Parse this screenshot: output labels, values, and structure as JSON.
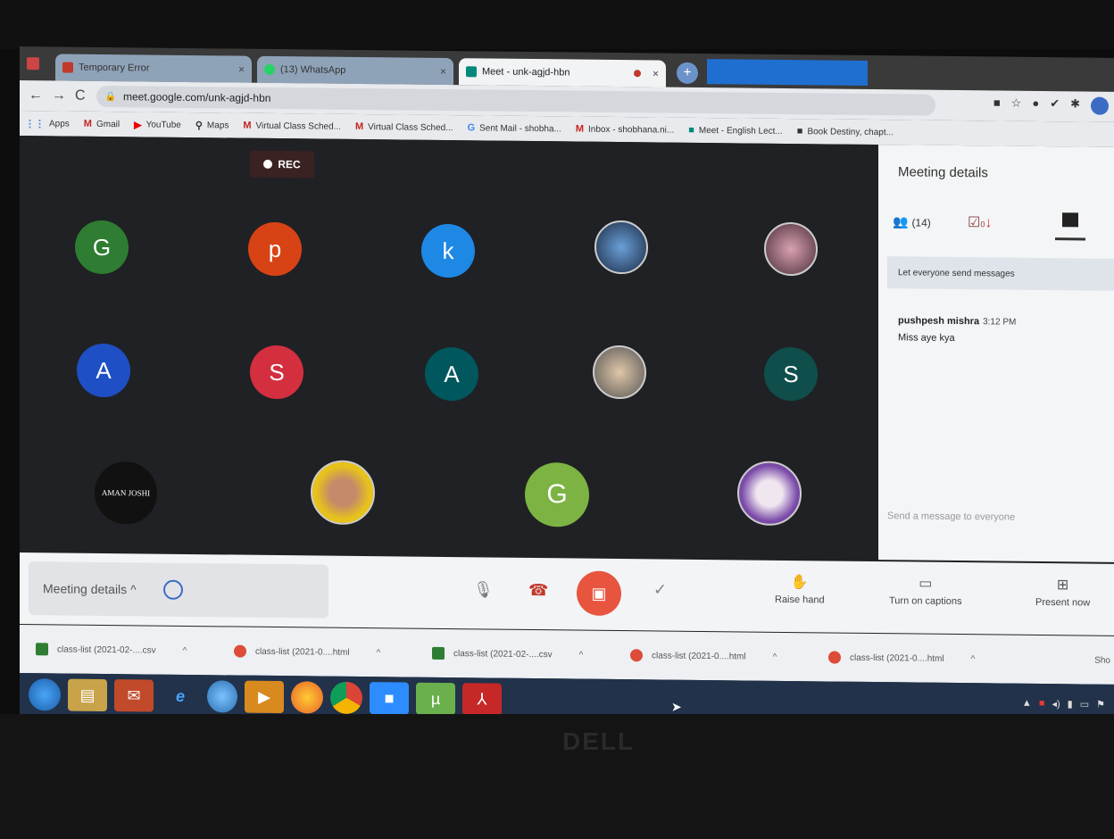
{
  "tabs": [
    {
      "label": "Temporary Error",
      "icon_color": "#c0392b"
    },
    {
      "label": "(13) WhatsApp",
      "icon_color": "#25d366"
    },
    {
      "label": "Meet - unk-agjd-hbn",
      "icon_color": "#00897b"
    }
  ],
  "address": {
    "url": "meet.google.com/unk-agjd-hbn"
  },
  "bookmarks": [
    {
      "label": "Apps",
      "icon": "apps-grid-icon"
    },
    {
      "label": "Gmail",
      "icon": "gmail-icon"
    },
    {
      "label": "YouTube",
      "icon": "youtube-icon"
    },
    {
      "label": "Maps",
      "icon": "maps-icon"
    },
    {
      "label": "Virtual Class Sched...",
      "icon": "gmail-icon"
    },
    {
      "label": "Virtual Class Sched...",
      "icon": "gmail-icon"
    },
    {
      "label": "Sent Mail - shobha...",
      "icon": "google-icon"
    },
    {
      "label": "Inbox - shobhana.ni...",
      "icon": "gmail-icon"
    },
    {
      "label": "Meet - English Lect...",
      "icon": "meet-icon"
    },
    {
      "label": "Book Destiny, chapt...",
      "icon": "book-icon"
    }
  ],
  "meeting": {
    "rec_label": "REC",
    "participants": [
      {
        "letter": "G",
        "color": "#2e7d32"
      },
      {
        "letter": "p",
        "color": "#d84315"
      },
      {
        "letter": "k",
        "color": "#1e88e5"
      },
      {
        "letter": "",
        "color": "#3a5a8a",
        "photo": true
      },
      {
        "letter": "",
        "color": "#6a4c63",
        "photo": true
      },
      {
        "letter": "A",
        "color": "#1e4fc4"
      },
      {
        "letter": "S",
        "color": "#d32f3f"
      },
      {
        "letter": "A",
        "color": "#00575e"
      },
      {
        "letter": "",
        "color": "#aaaaaa",
        "photo": true
      },
      {
        "letter": "S",
        "color": "#0f4e4a"
      },
      {
        "letter": "AMAN JOSHI",
        "color": "#111111"
      },
      {
        "letter": "",
        "color": "#e7c21b",
        "photo": true
      },
      {
        "letter": "G",
        "color": "#7cb342"
      },
      {
        "letter": "",
        "color": "#7a4aa8",
        "photo": true
      }
    ]
  },
  "panel": {
    "title": "Meeting details",
    "people_count": "(14)",
    "attendance_count": "0",
    "let_everyone": "Let everyone send messages",
    "message": {
      "sender": "pushpesh mishra",
      "time": "3:12 PM",
      "text": "Miss aye kya"
    },
    "send_placeholder": "Send a message to everyone"
  },
  "controls": {
    "meeting_details": "Meeting details",
    "raise_hand": "Raise hand",
    "captions": "Turn on captions",
    "present": "Present now"
  },
  "downloads": [
    {
      "label": "class-list (2021-02-....csv",
      "icon_color": "#2e7d32"
    },
    {
      "label": "class-list (2021-0....html",
      "icon_color": "#dd4b39"
    },
    {
      "label": "class-list (2021-02-....csv",
      "icon_color": "#2e7d32"
    },
    {
      "label": "class-list (2021-0....html",
      "icon_color": "#dd4b39"
    },
    {
      "label": "class-list (2021-0....html",
      "icon_color": "#dd4b39"
    }
  ],
  "downloads_show_all": "Sho",
  "taskbar": [
    {
      "name": "explorer",
      "color": "#c9a34a"
    },
    {
      "name": "outlook",
      "color": "#c14a2a"
    },
    {
      "name": "ie",
      "color": "#2d6fc4"
    },
    {
      "name": "circle-app",
      "color": "#3c8fd8"
    },
    {
      "name": "media-player",
      "color": "#d88a1e"
    },
    {
      "name": "firefox",
      "color": "#e8602a"
    },
    {
      "name": "chrome",
      "color": "#d44"
    },
    {
      "name": "zoom",
      "color": "#2d8cff"
    },
    {
      "name": "utorrent",
      "color": "#6ab04c"
    },
    {
      "name": "acrobat",
      "color": "#c62828"
    }
  ],
  "brand": "DELL"
}
